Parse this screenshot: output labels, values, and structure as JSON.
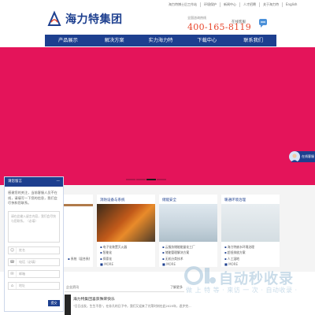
{
  "top_links": [
    "海力特博士后工作站",
    "环境保护",
    "新闻中心",
    "人才招聘",
    "关于海力特",
    "English"
  ],
  "header": {
    "logo_text": "海力特集团",
    "hotline_label": "全国咨询热线",
    "hotline_number": "400-165-8119",
    "online_consult": "在线客服"
  },
  "nav": [
    "产品展示",
    "解决方案",
    "实力海力特",
    "下载中心",
    "联系我们"
  ],
  "banner": {
    "color": "#e4145a"
  },
  "side_service": {
    "label": "在线客服"
  },
  "cards": [
    {
      "title": "",
      "items": [
        "",
        "",
        "",
        "系统（混合系统）"
      ],
      "more": ""
    },
    {
      "title": "消防设备与系统",
      "items": [
        "电子化装置灭火器",
        "智能化",
        "探索化",
        "系统化"
      ],
      "more": "MORE"
    },
    {
      "title": "储能安全",
      "items": [
        "云服务储能能量化工厂",
        "储能管理解决方案",
        "无机分类技术"
      ],
      "more": "MORE"
    },
    {
      "title": "暖通环境治理",
      "items": [
        "海力特废水环境治理",
        "超低排放方案",
        "人工湿地"
      ],
      "more": "MORE"
    }
  ],
  "news": {
    "label": "企业资讯",
    "more": "了解更多",
    "title": "海力特集团喜获殊荣快乐",
    "body": "\"日日出发，生生不息\"，在非凡的日子中，我们又迎来了光荣时刻在此2025年，逐步完..."
  },
  "chat": {
    "title": "请您留言",
    "minimize": "—",
    "intro": "感谢您的关注，当前客服人员不在线，请填写一下您的信息，我们会尽快和您联系。",
    "textarea_placeholder": "请在此输入留言内容，我们会尽快与您联系。（必填）",
    "fields": [
      {
        "icon": "user-icon",
        "placeholder": "姓名"
      },
      {
        "icon": "phone-icon",
        "placeholder": "电话（必填）"
      },
      {
        "icon": "email-icon",
        "placeholder": "邮箱"
      },
      {
        "icon": "location-icon",
        "placeholder": "地址"
      }
    ],
    "submit": "提交"
  },
  "watermark": {
    "title": "自动秒收录",
    "sub": "做 上 特 等 · 来访 一 次 · 自动收录 ·"
  },
  "colors": {
    "brand": "#1d3f8f",
    "accent": "#e8472d",
    "banner": "#e4145a"
  }
}
